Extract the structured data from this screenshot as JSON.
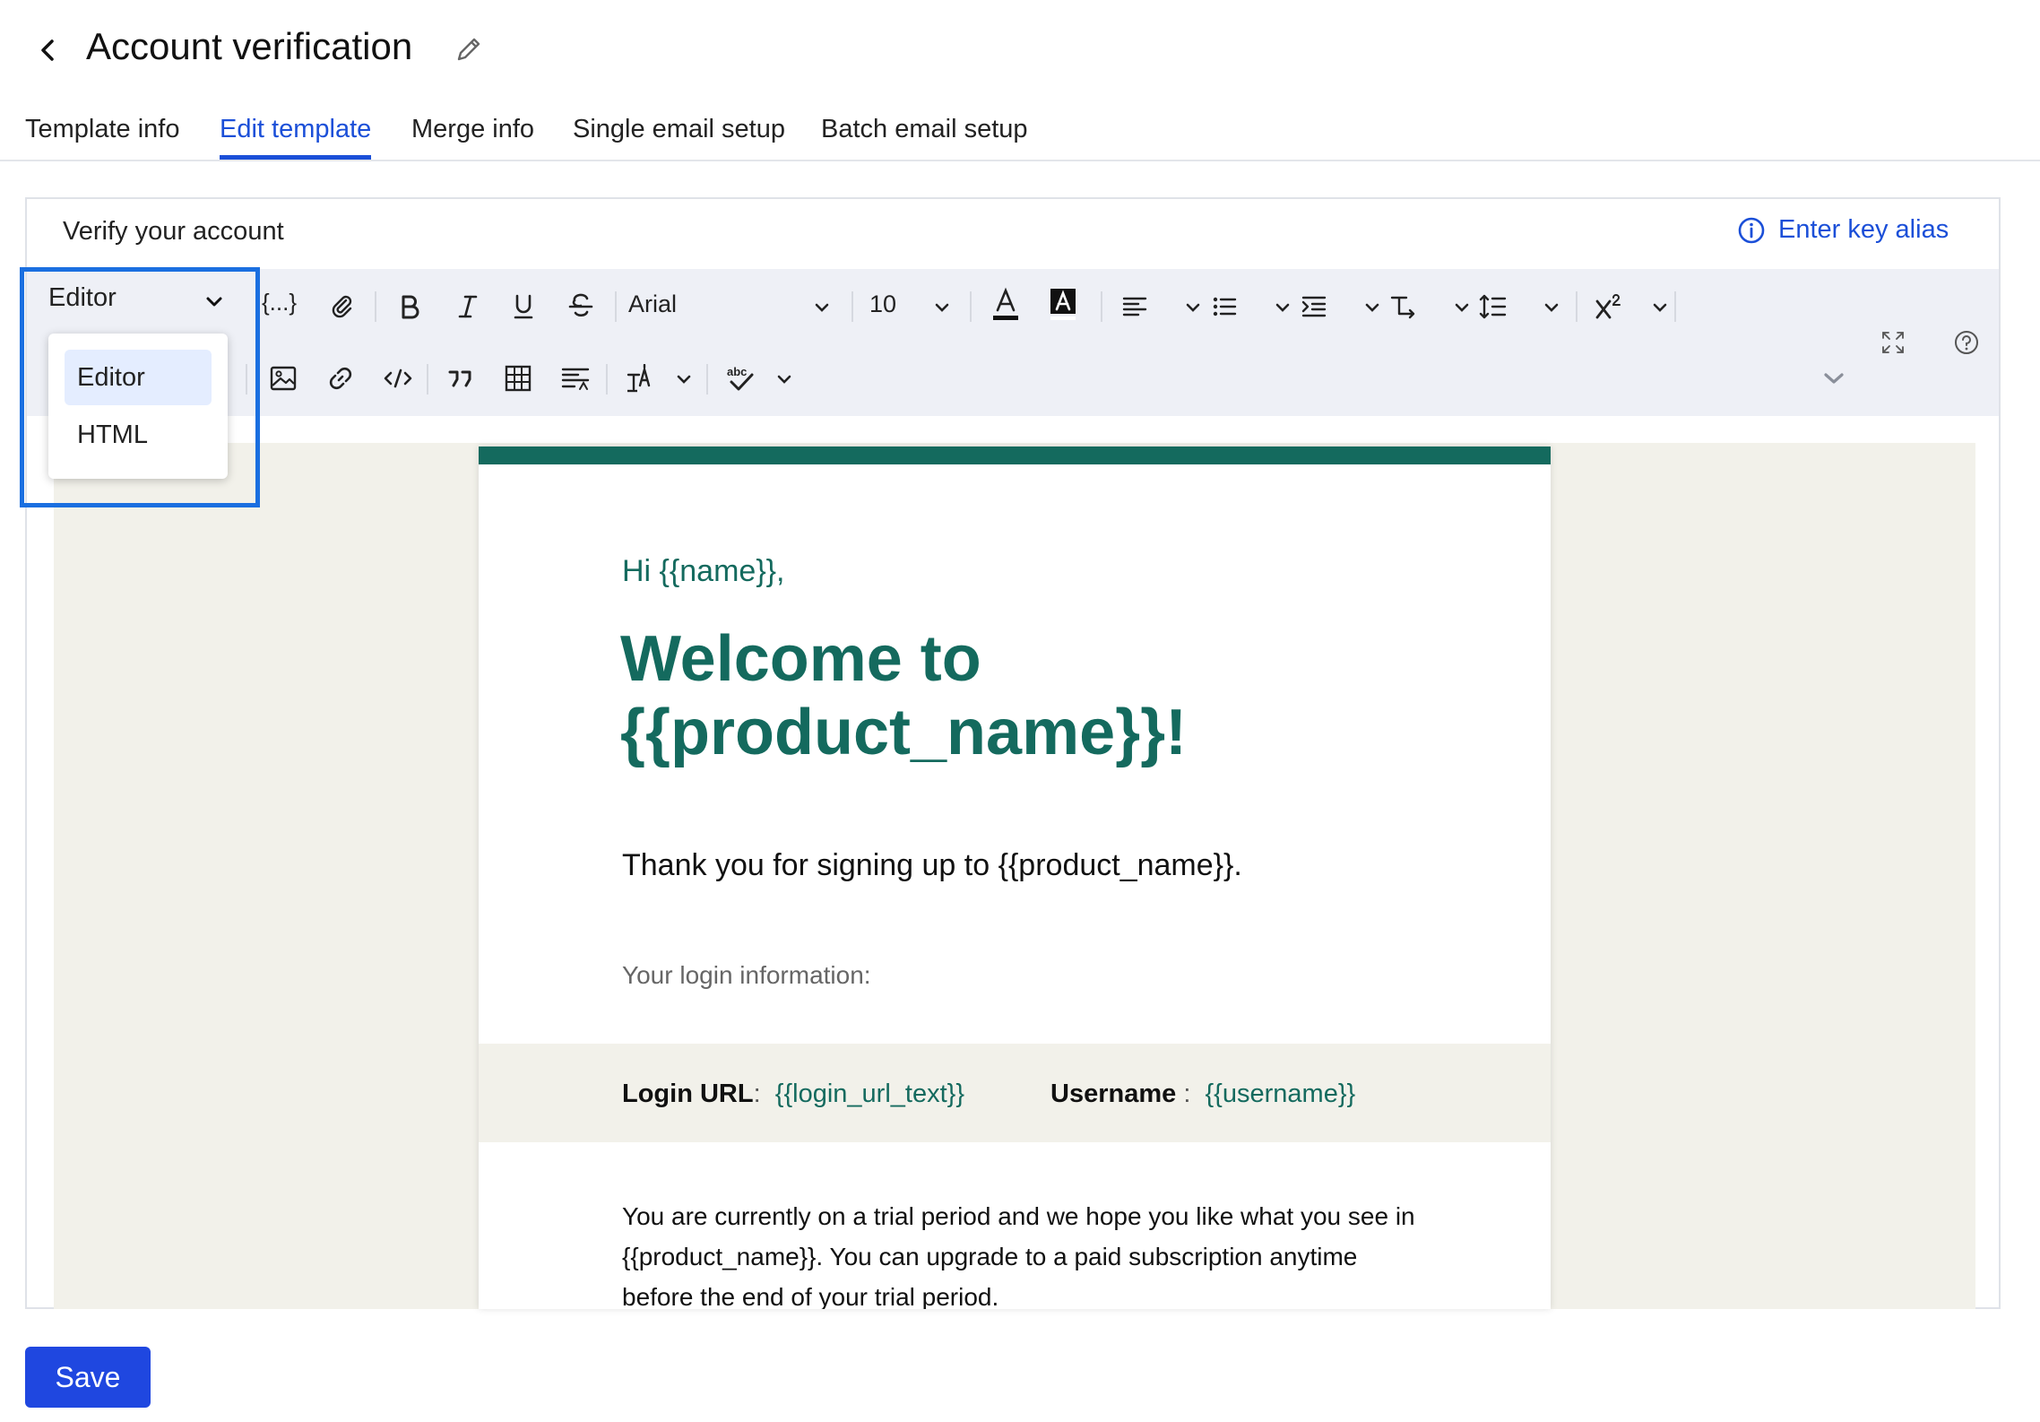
{
  "header": {
    "title": "Account verification",
    "back_icon": "chevron-left-icon",
    "edit_icon": "pencil-icon"
  },
  "tabs": [
    {
      "label": "Template info",
      "active": false
    },
    {
      "label": "Edit template",
      "active": true
    },
    {
      "label": "Merge info",
      "active": false
    },
    {
      "label": "Single email setup",
      "active": false
    },
    {
      "label": "Batch email setup",
      "active": false
    }
  ],
  "editor": {
    "subject": "Verify your account",
    "alias_link": "Enter key alias",
    "mode": {
      "selected": "Editor",
      "options": [
        "Editor",
        "HTML"
      ]
    },
    "toolbar": {
      "merge_field": "{...}",
      "font_family": "Arial",
      "font_size": "10"
    }
  },
  "email": {
    "greeting": "Hi {{name}},",
    "headline": "Welcome to {{product_name}}!",
    "thanks": "Thank you for signing up to {{product_name}}.",
    "login_title": "Your login information:",
    "login_url_label": "Login URL",
    "login_url_value": "{{login_url_text}}",
    "username_label": "Username",
    "username_value": "{{username}}",
    "separator": ":",
    "paragraph": "You are currently on a trial period and we hope you like what you see in {{product_name}}. You can upgrade to a paid subscription anytime before the end of your trial period."
  },
  "footer": {
    "save_label": "Save"
  },
  "colors": {
    "accent": "#1b4fd8",
    "brand_green": "#146a5e",
    "highlight": "#1a6fe0",
    "save_button": "#1f47e0"
  }
}
